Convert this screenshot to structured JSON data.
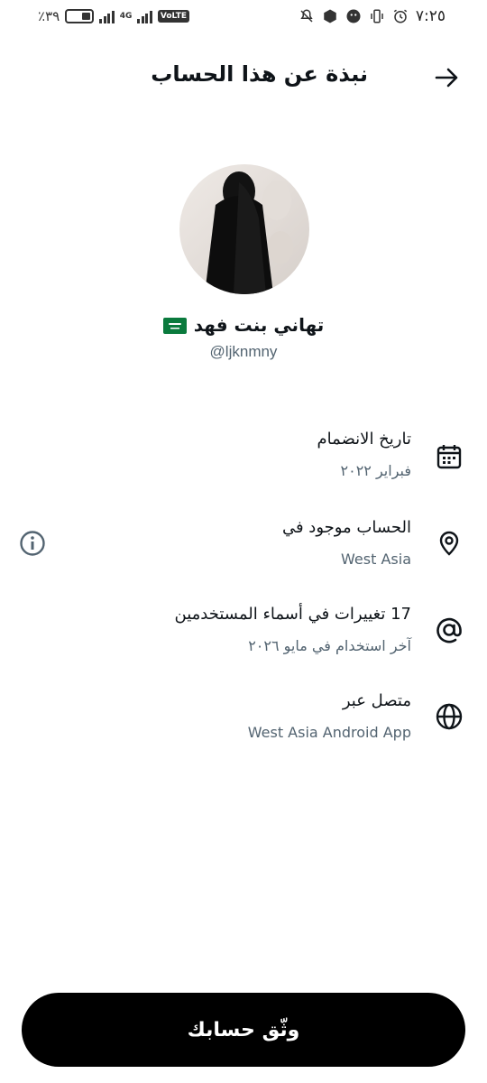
{
  "status_bar": {
    "battery": "٪٣٩",
    "battery_level": 0.39,
    "network": "4G",
    "volte": "VoLTE",
    "time": "٧:٢٥"
  },
  "header": {
    "title": "نبذة عن هذا الحساب",
    "back_icon": "arrow-right-icon"
  },
  "profile": {
    "name": "تهاني بنت فهد",
    "flag_icon": "saudi-flag-icon",
    "handle": "@ljknmny"
  },
  "info_rows": [
    {
      "icon": "calendar-icon",
      "title": "تاريخ الانضمام",
      "subtitle": "فبراير ٢٠٢٢"
    },
    {
      "icon": "location-pin-icon",
      "title": "الحساب موجود في",
      "subtitle": "West Asia"
    },
    {
      "icon": "at-sign-icon",
      "title": "17 تغييرات في أسماء المستخدمين",
      "subtitle": "آخر استخدام في مايو ٢٠٢٦"
    },
    {
      "icon": "globe-icon",
      "title": "متصل عبر",
      "subtitle": "West Asia Android App"
    }
  ],
  "info_button_icon": "info-icon",
  "verify_button": {
    "label": "وثّق حسابك"
  }
}
